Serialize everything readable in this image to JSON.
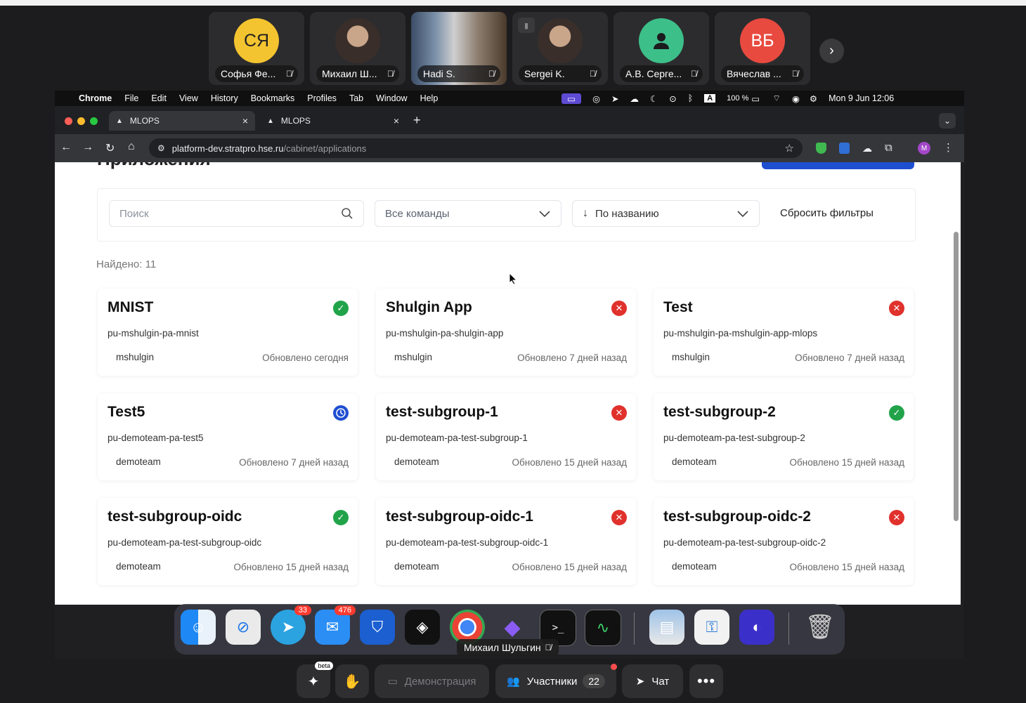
{
  "participants": [
    {
      "initials": "СЯ",
      "name": "Софья Фе...",
      "color": "#f4c430"
    },
    {
      "initials": "",
      "name": "Михаил Ш...",
      "color": ""
    },
    {
      "initials": "",
      "name": "Hadi S.",
      "color": ""
    },
    {
      "initials": "",
      "name": "Sergei K.",
      "color": ""
    },
    {
      "initials": "",
      "name": "А.В. Серге...",
      "color": "#3dbf8a"
    },
    {
      "initials": "ВБ",
      "name": "Вячеслав ...",
      "color": "#e84a3f"
    }
  ],
  "mac_menu": {
    "app": "Chrome",
    "items": [
      "File",
      "Edit",
      "View",
      "History",
      "Bookmarks",
      "Profiles",
      "Tab",
      "Window",
      "Help"
    ],
    "battery": "100 %",
    "datetime": "Mon 9 Jun  12:06"
  },
  "browser": {
    "tabs": [
      {
        "label": "MLOPS"
      },
      {
        "label": "MLOPS"
      }
    ],
    "url_host": "platform-dev.stratpro.hse.ru",
    "url_path": "/cabinet/applications",
    "profile_initial": "M"
  },
  "page": {
    "title_partial": "Приложения",
    "search_placeholder": "Поиск",
    "team_select": "Все команды",
    "sort_select": "По названию",
    "reset_filters": "Сбросить фильтры",
    "found_label": "Найдено: 11"
  },
  "status_colors": {
    "ok": "#21a34a",
    "error": "#e0312c",
    "pending": "#1f4fd1"
  },
  "cards": [
    {
      "title": "MNIST",
      "slug": "pu-mshulgin-pa-mnist",
      "team": "mshulgin",
      "updated": "Обновлено сегодня",
      "status": "ok"
    },
    {
      "title": "Shulgin App",
      "slug": "pu-mshulgin-pa-shulgin-app",
      "team": "mshulgin",
      "updated": "Обновлено 7 дней назад",
      "status": "error"
    },
    {
      "title": "Test",
      "slug": "pu-mshulgin-pa-mshulgin-app-mlops",
      "team": "mshulgin",
      "updated": "Обновлено 7 дней назад",
      "status": "error"
    },
    {
      "title": "Test5",
      "slug": "pu-demoteam-pa-test5",
      "team": "demoteam",
      "updated": "Обновлено 7 дней назад",
      "status": "pending"
    },
    {
      "title": "test-subgroup-1",
      "slug": "pu-demoteam-pa-test-subgroup-1",
      "team": "demoteam",
      "updated": "Обновлено 15 дней назад",
      "status": "error"
    },
    {
      "title": "test-subgroup-2",
      "slug": "pu-demoteam-pa-test-subgroup-2",
      "team": "demoteam",
      "updated": "Обновлено 15 дней назад",
      "status": "ok"
    },
    {
      "title": "test-subgroup-oidc",
      "slug": "pu-demoteam-pa-test-subgroup-oidc",
      "team": "demoteam",
      "updated": "Обновлено 15 дней назад",
      "status": "ok"
    },
    {
      "title": "test-subgroup-oidc-1",
      "slug": "pu-demoteam-pa-test-subgroup-oidc-1",
      "team": "demoteam",
      "updated": "Обновлено 15 дней назад",
      "status": "error"
    },
    {
      "title": "test-subgroup-oidc-2",
      "slug": "pu-demoteam-pa-test-subgroup-oidc-2",
      "team": "demoteam",
      "updated": "Обновлено 15 дней назад",
      "status": "error"
    }
  ],
  "dock": {
    "telegram_badge": "33",
    "mail_badge": "476",
    "tooltip": "Михаил Шульгин"
  },
  "conference_bar": {
    "ai_badge": "beta",
    "demo_label": "Демонстрация",
    "participants_label": "Участники",
    "participants_count": "22",
    "chat_label": "Чат"
  }
}
